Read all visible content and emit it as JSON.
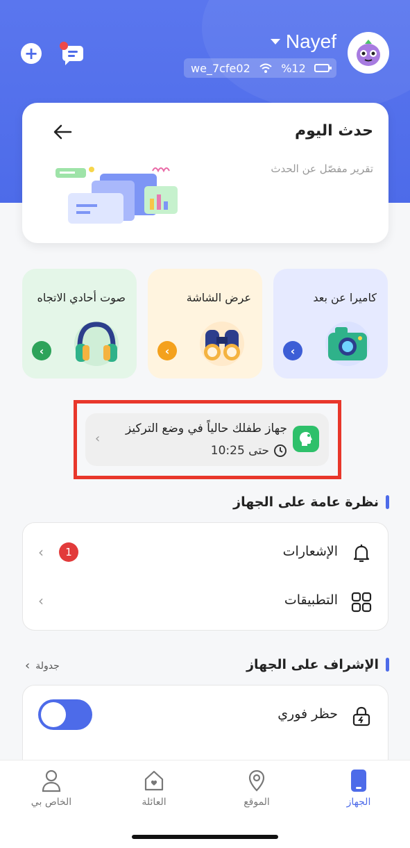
{
  "header": {
    "user_name": "Nayef",
    "wifi_name": "we_7cfe02",
    "battery": "%12"
  },
  "event_card": {
    "title": "حدث اليوم",
    "description": "تقرير مفصّل عن الحدث"
  },
  "features": [
    {
      "label": "كاميرا عن بعد",
      "accent": "#3d5ed6",
      "bg": "#e6eaff"
    },
    {
      "label": "عرض الشاشة",
      "accent": "#f4a11d",
      "bg": "#fff4df"
    },
    {
      "label": "صوت أحادي الاتجاه",
      "accent": "#2ea35a",
      "bg": "#e4f6e8"
    }
  ],
  "focus_banner": {
    "text": "جهاز طفلك حالياً في وضع التركيز",
    "until": "حتى 10:25"
  },
  "device_overview": {
    "title": "نظرة عامة على الجهاز",
    "items": [
      {
        "label": "الإشعارات",
        "badge": "1",
        "icon": "bell-icon"
      },
      {
        "label": "التطبيقات",
        "icon": "apps-grid-icon"
      }
    ]
  },
  "device_supervision": {
    "title": "الإشراف على الجهاز",
    "schedule_link": "جدولة",
    "items": [
      {
        "label": "حظر فوري",
        "icon": "lock-bolt-icon",
        "toggle_on": true
      }
    ]
  },
  "tabbar": {
    "tabs": [
      {
        "label": "الخاص بي",
        "icon": "person-icon"
      },
      {
        "label": "العائلة",
        "icon": "home-heart-icon"
      },
      {
        "label": "الموقع",
        "icon": "location-pin-icon"
      },
      {
        "label": "الجهاز",
        "icon": "device-icon",
        "active": true
      }
    ]
  }
}
